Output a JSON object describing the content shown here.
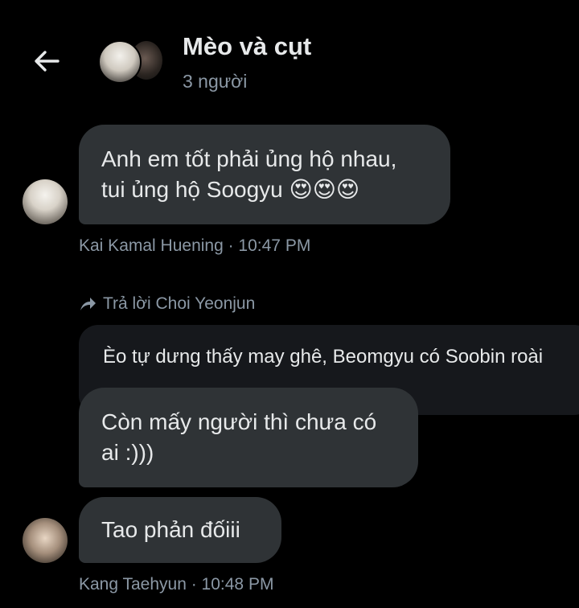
{
  "header": {
    "title": "Mèo và cụt",
    "subtitle": "3 người"
  },
  "messages": [
    {
      "line1": "Anh em tốt phải ủng hộ nhau,",
      "line2": "tui ủng hộ Soogyu",
      "emoji": "😍😍😍",
      "meta": "Kai Kamal Huening · 10:47 PM"
    },
    {
      "reply_label": "Trả lời Choi Yeonjun",
      "quoted": "Èo tự dưng thấy may ghê, Beomgyu có Soobin roài",
      "line1": "Còn mấy người thì chưa có",
      "line2": "ai :)))"
    },
    {
      "text": "Tao phản đốiii",
      "meta": "Kang Taehyun · 10:48 PM"
    }
  ],
  "icons": [
    "back-arrow-icon",
    "reply-arrow-icon"
  ]
}
